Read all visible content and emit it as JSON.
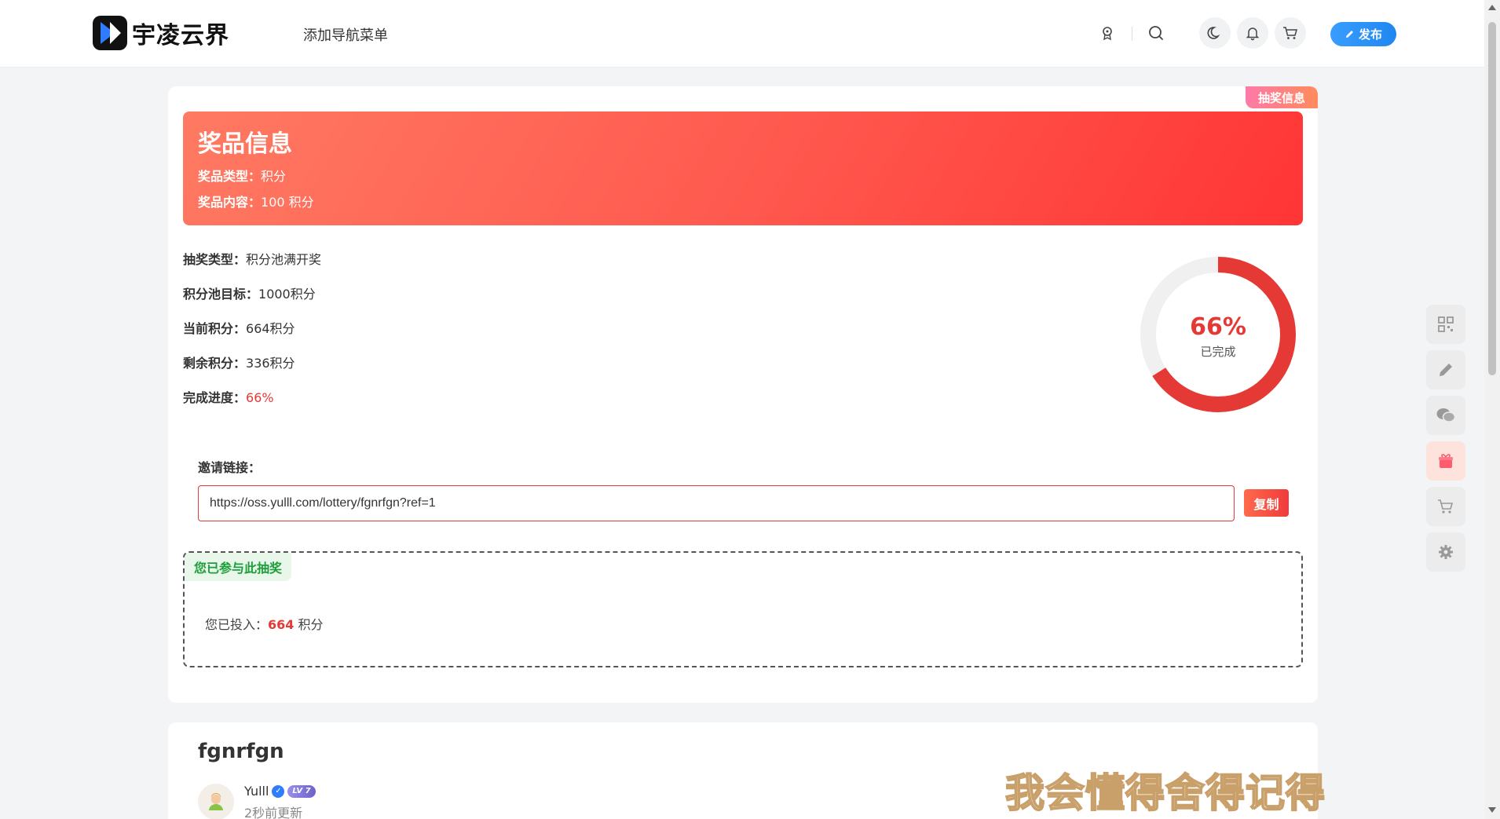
{
  "header": {
    "logo_text": "宇凌云界",
    "nav_add": "添加导航菜单",
    "publish_label": "发布"
  },
  "lottery": {
    "corner_tag": "抽奖信息",
    "banner": {
      "title": "奖品信息",
      "type_label": "奖品类型：",
      "type_value": "积分",
      "content_label": "奖品内容：",
      "content_value": "100 积分"
    },
    "info": [
      {
        "label": "抽奖类型：",
        "value": "积分池满开奖"
      },
      {
        "label": "积分池目标：",
        "value": "1000积分"
      },
      {
        "label": "当前积分：",
        "value": "664积分"
      },
      {
        "label": "剩余积分：",
        "value": "336积分"
      },
      {
        "label": "完成进度：",
        "value": "66%"
      }
    ],
    "progress": {
      "value": 0.66,
      "percent_text": "66%",
      "caption": "已完成",
      "color": "#e53935"
    },
    "invite": {
      "label": "邀请链接：",
      "url": "https://oss.yulll.com/lottery/fgnrfgn?ref=1",
      "copy_label": "复制"
    },
    "joined": {
      "tag": "您已参与此抽奖",
      "prefix": "您已投入：",
      "amount": "664",
      "suffix": " 积分"
    }
  },
  "post": {
    "title": "fgnrfgn",
    "author": "Yulll",
    "level": "LV 7",
    "updated": "2秒前更新"
  },
  "watermark": "我会懂得舍得记得",
  "float_bar": [
    "qrcode-icon",
    "pencil-icon",
    "wechat-icon",
    "gift-icon",
    "cart-icon",
    "gear-icon"
  ]
}
